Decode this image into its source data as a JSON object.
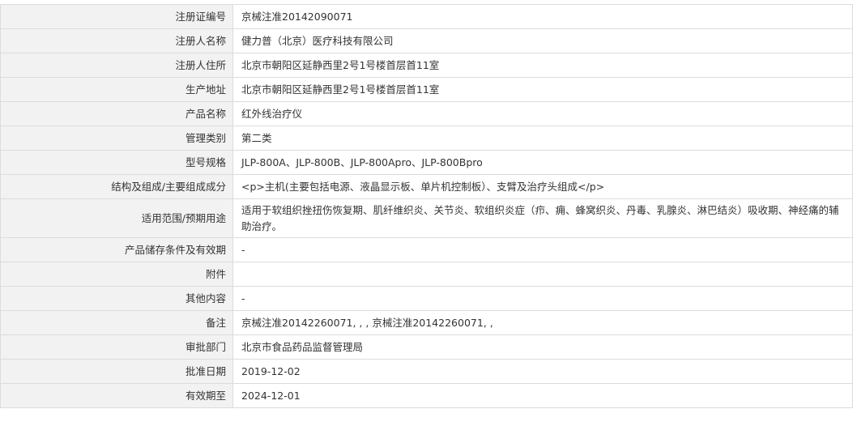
{
  "rows": [
    {
      "label": "注册证编号",
      "value": "京械注准20142090071",
      "tall": false
    },
    {
      "label": "注册人名称",
      "value": "健力普（北京）医疗科技有限公司",
      "tall": false
    },
    {
      "label": "注册人住所",
      "value": "北京市朝阳区延静西里2号1号楼首层首11室",
      "tall": false
    },
    {
      "label": "生产地址",
      "value": "北京市朝阳区延静西里2号1号楼首层首11室",
      "tall": false
    },
    {
      "label": "产品名称",
      "value": "红外线治疗仪",
      "tall": false
    },
    {
      "label": "管理类别",
      "value": "第二类",
      "tall": false
    },
    {
      "label": "型号规格",
      "value": "JLP-800A、JLP-800B、JLP-800Apro、JLP-800Bpro",
      "tall": false
    },
    {
      "label": "结构及组成/主要组成成分",
      "value": "<p>主机(主要包括电源、液晶显示板、单片机控制板）、支臂及治疗头组成</p>",
      "tall": false
    },
    {
      "label": "适用范围/预期用途",
      "value": "适用于软组织挫扭伤恢复期、肌纤维织炎、关节炎、软组织炎症（疖、痈、蜂窝织炎、丹毒、乳腺炎、淋巴结炎）吸收期、神经痛的辅助治疗。",
      "tall": true
    },
    {
      "label": "产品储存条件及有效期",
      "value": "-",
      "tall": false
    },
    {
      "label": "附件",
      "value": "",
      "tall": false
    },
    {
      "label": "其他内容",
      "value": "-",
      "tall": false
    },
    {
      "label": "备注",
      "value": "京械注准20142260071, , , 京械注准20142260071, ,",
      "tall": false
    },
    {
      "label": "审批部门",
      "value": "北京市食品药品监督管理局",
      "tall": false
    },
    {
      "label": "批准日期",
      "value": "2019-12-02",
      "tall": false
    },
    {
      "label": "有效期至",
      "value": "2024-12-01",
      "tall": false
    }
  ]
}
